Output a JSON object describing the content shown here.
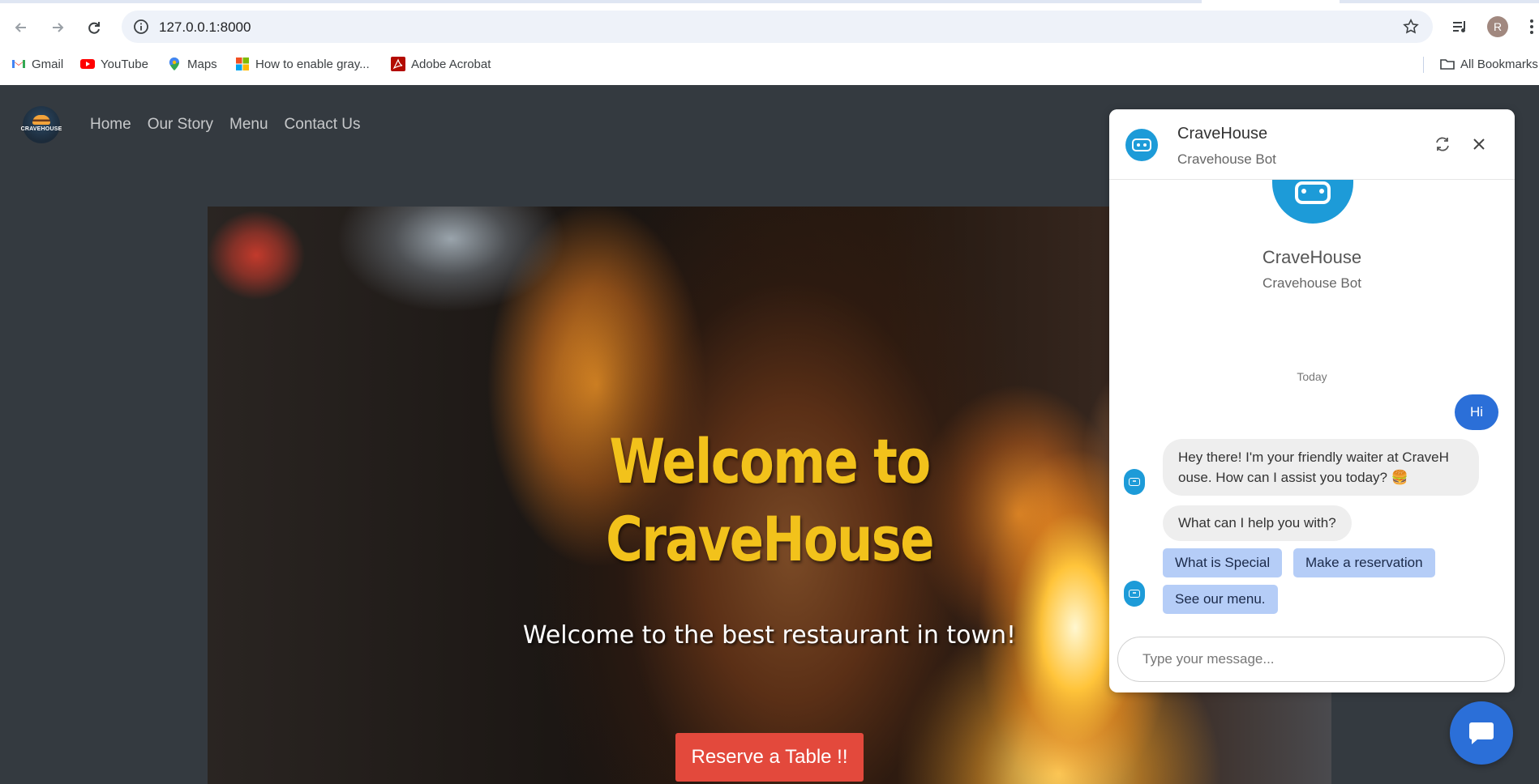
{
  "browser": {
    "url": "127.0.0.1:8000",
    "avatar_initial": "R",
    "bookmarks": [
      {
        "label": "Gmail",
        "icon": "gmail-icon"
      },
      {
        "label": "YouTube",
        "icon": "youtube-icon"
      },
      {
        "label": "Maps",
        "icon": "maps-icon"
      },
      {
        "label": "How to enable gray...",
        "icon": "windows-icon"
      },
      {
        "label": "Adobe Acrobat",
        "icon": "acrobat-icon"
      }
    ],
    "all_bookmarks_label": "All Bookmarks"
  },
  "site": {
    "logo_text": "CRAVEHOUSE",
    "nav": [
      "Home",
      "Our Story",
      "Menu",
      "Contact Us"
    ],
    "hero": {
      "title_line1": "Welcome to",
      "title_line2": "CraveHouse",
      "subtitle": "Welcome to the best restaurant in town!",
      "cta": "Reserve a Table !!"
    }
  },
  "chat": {
    "title": "CraveHouse",
    "subtitle": "Cravehouse Bot",
    "intro_name": "CraveHouse",
    "intro_role": "Cravehouse Bot",
    "day_separator": "Today",
    "user_message": "Hi",
    "bot_message_1": "Hey there! I'm your friendly waiter at CraveH ouse. How can I assist you today? 🍔",
    "bot_message_2": "What can I help you with?",
    "quick_replies": [
      "What is Special",
      "Make a reservation",
      "See our menu."
    ],
    "input_placeholder": "Type your message..."
  },
  "colors": {
    "accent_yellow": "#f2c21b",
    "cta_red": "#e3493c",
    "chat_blue": "#2b6fd8",
    "bot_blue": "#1d9bd8",
    "quick_reply_bg": "#b5cdf7",
    "site_bg": "#343a40"
  }
}
